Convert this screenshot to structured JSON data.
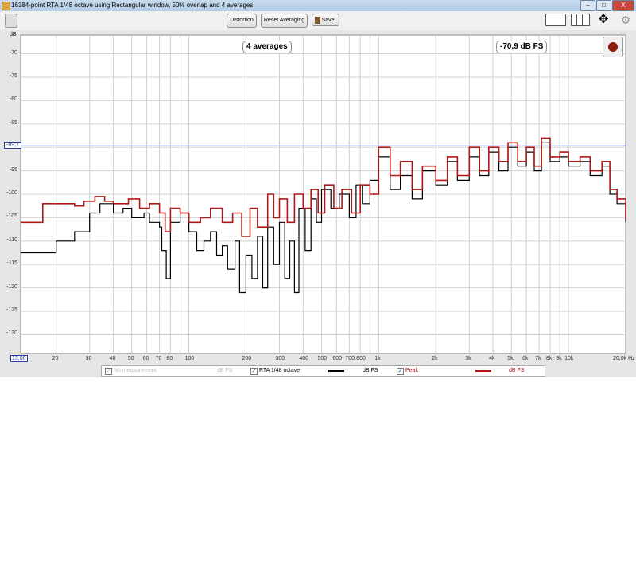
{
  "window": {
    "title": "16384-point RTA 1/48 octave using Rectangular window, 50% overlap and 4 averages",
    "minimize": "–",
    "maximize": "□",
    "close": "X"
  },
  "toolbar": {
    "distortion": "Distortion",
    "reset": "Reset Averaging",
    "save": "Save"
  },
  "overlay": {
    "averages": "4 averages",
    "level": "-70,9 dB FS"
  },
  "axis": {
    "unit": "dB",
    "cursor_y": "-89,7",
    "cursor_x": "13,00"
  },
  "legend": [
    {
      "label": "No measurement",
      "unit": "dB FS",
      "checked": true,
      "enabled": false,
      "color": "#c0c0c0"
    },
    {
      "label": "RTA 1/48 octave",
      "unit": "dB FS",
      "checked": true,
      "enabled": true,
      "color": "#000000"
    },
    {
      "label": "Peak",
      "unit": "dB FS",
      "checked": true,
      "enabled": true,
      "color": "#b01818"
    }
  ],
  "chart_data": {
    "type": "line",
    "xscale": "log",
    "xlim": [
      13,
      20000
    ],
    "ylim": [
      -134,
      -66
    ],
    "yticks": [
      -70,
      -75,
      -80,
      -85,
      -90,
      -95,
      -100,
      -105,
      -110,
      -115,
      -120,
      -125,
      -130
    ],
    "ytick_labels": [
      "-70",
      "-75",
      "-80",
      "-85",
      "-90",
      "-95",
      "-100",
      "-105",
      "-110",
      "-115",
      "-120",
      "-125",
      "-130"
    ],
    "xticks": [
      20,
      30,
      40,
      50,
      60,
      70,
      80,
      100,
      200,
      300,
      400,
      500,
      600,
      700,
      800,
      1000,
      2000,
      3000,
      4000,
      5000,
      6000,
      7000,
      8000,
      9000,
      10000,
      20000
    ],
    "xtick_labels": [
      "20",
      "30",
      "40",
      "50",
      "60",
      "70",
      "80",
      "100",
      "200",
      "300",
      "400",
      "500",
      "600",
      "700",
      "800",
      "1k",
      "2k",
      "3k",
      "4k",
      "5k",
      "6k",
      "7k",
      "8k",
      "9k",
      "10k",
      "20,0k Hz"
    ],
    "cursor_level": -89.7,
    "series": [
      {
        "name": "RTA 1/48 octave",
        "color": "#000000",
        "points": [
          [
            13,
            -112.5
          ],
          [
            20,
            -112.5
          ],
          [
            20,
            -110
          ],
          [
            25,
            -110
          ],
          [
            25,
            -108
          ],
          [
            30,
            -108
          ],
          [
            30,
            -104
          ],
          [
            34,
            -104
          ],
          [
            34,
            -102
          ],
          [
            40,
            -104
          ],
          [
            45,
            -103
          ],
          [
            50,
            -105
          ],
          [
            58,
            -104
          ],
          [
            62,
            -106
          ],
          [
            70,
            -107
          ],
          [
            72,
            -112
          ],
          [
            76,
            -118
          ],
          [
            80,
            -106
          ],
          [
            90,
            -104
          ],
          [
            100,
            -108
          ],
          [
            110,
            -112
          ],
          [
            120,
            -110
          ],
          [
            130,
            -108
          ],
          [
            140,
            -113
          ],
          [
            150,
            -111
          ],
          [
            160,
            -116
          ],
          [
            175,
            -110
          ],
          [
            185,
            -121
          ],
          [
            200,
            -113
          ],
          [
            215,
            -118
          ],
          [
            230,
            -109
          ],
          [
            245,
            -120
          ],
          [
            260,
            -107
          ],
          [
            280,
            -115
          ],
          [
            300,
            -106
          ],
          [
            320,
            -118
          ],
          [
            340,
            -110
          ],
          [
            360,
            -121
          ],
          [
            380,
            -103
          ],
          [
            410,
            -112
          ],
          [
            440,
            -101
          ],
          [
            470,
            -106
          ],
          [
            500,
            -99
          ],
          [
            560,
            -103
          ],
          [
            620,
            -100
          ],
          [
            700,
            -105
          ],
          [
            760,
            -98
          ],
          [
            820,
            -102
          ],
          [
            900,
            -97
          ],
          [
            1000,
            -92
          ],
          [
            1150,
            -99
          ],
          [
            1300,
            -96
          ],
          [
            1500,
            -101
          ],
          [
            1700,
            -95
          ],
          [
            2000,
            -98
          ],
          [
            2300,
            -93
          ],
          [
            2600,
            -97
          ],
          [
            3000,
            -92
          ],
          [
            3400,
            -96
          ],
          [
            3800,
            -91
          ],
          [
            4300,
            -95
          ],
          [
            4800,
            -90
          ],
          [
            5400,
            -94
          ],
          [
            6000,
            -91
          ],
          [
            6600,
            -95
          ],
          [
            7200,
            -89
          ],
          [
            8000,
            -93
          ],
          [
            9000,
            -92
          ],
          [
            10000,
            -94
          ],
          [
            11500,
            -93
          ],
          [
            13000,
            -96
          ],
          [
            15000,
            -94
          ],
          [
            16500,
            -100
          ],
          [
            18000,
            -102
          ],
          [
            20000,
            -106
          ]
        ]
      },
      {
        "name": "Peak",
        "color": "#b01818",
        "points": [
          [
            13,
            -106
          ],
          [
            17,
            -106
          ],
          [
            17,
            -102
          ],
          [
            25,
            -102.5
          ],
          [
            28,
            -101.5
          ],
          [
            32,
            -100.5
          ],
          [
            36,
            -101.5
          ],
          [
            40,
            -102
          ],
          [
            48,
            -101
          ],
          [
            55,
            -103
          ],
          [
            62,
            -102
          ],
          [
            70,
            -104
          ],
          [
            75,
            -108
          ],
          [
            80,
            -103
          ],
          [
            90,
            -104
          ],
          [
            100,
            -106
          ],
          [
            115,
            -105
          ],
          [
            130,
            -103
          ],
          [
            150,
            -106
          ],
          [
            170,
            -104
          ],
          [
            190,
            -109
          ],
          [
            210,
            -103
          ],
          [
            230,
            -107
          ],
          [
            260,
            -100
          ],
          [
            280,
            -105
          ],
          [
            300,
            -101
          ],
          [
            330,
            -106
          ],
          [
            360,
            -100
          ],
          [
            400,
            -103
          ],
          [
            440,
            -99
          ],
          [
            480,
            -104
          ],
          [
            520,
            -98
          ],
          [
            580,
            -103
          ],
          [
            640,
            -99
          ],
          [
            720,
            -104
          ],
          [
            800,
            -98
          ],
          [
            900,
            -100
          ],
          [
            1000,
            -90
          ],
          [
            1150,
            -96
          ],
          [
            1300,
            -93
          ],
          [
            1500,
            -99
          ],
          [
            1700,
            -94
          ],
          [
            2000,
            -97
          ],
          [
            2300,
            -92
          ],
          [
            2600,
            -96
          ],
          [
            3000,
            -90
          ],
          [
            3400,
            -95
          ],
          [
            3800,
            -90
          ],
          [
            4300,
            -93
          ],
          [
            4800,
            -89
          ],
          [
            5400,
            -93
          ],
          [
            6000,
            -90
          ],
          [
            6600,
            -94
          ],
          [
            7200,
            -88
          ],
          [
            8000,
            -92
          ],
          [
            9000,
            -91
          ],
          [
            10000,
            -93
          ],
          [
            11500,
            -92
          ],
          [
            13000,
            -95
          ],
          [
            15000,
            -93
          ],
          [
            16500,
            -99
          ],
          [
            18000,
            -101
          ],
          [
            20000,
            -105
          ]
        ]
      }
    ]
  }
}
